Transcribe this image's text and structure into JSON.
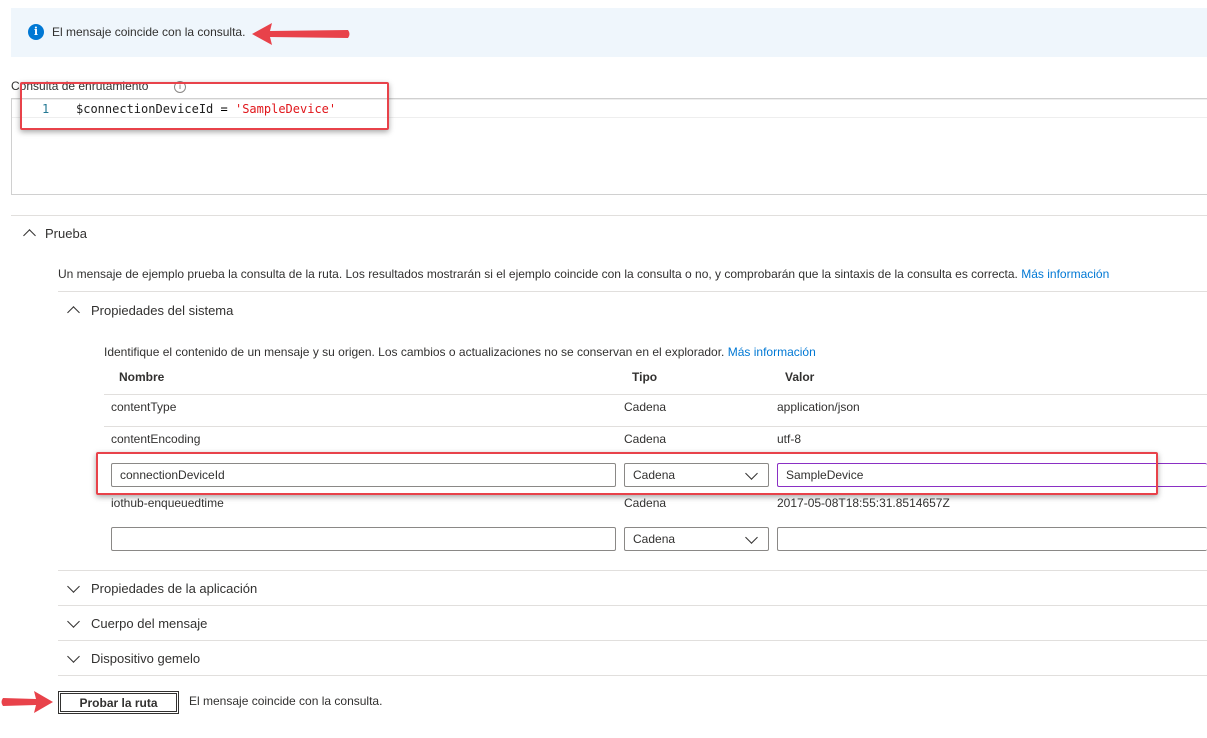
{
  "banner": {
    "message": "El mensaje coincide con la consulta.",
    "icon": "info-icon"
  },
  "query": {
    "label": "Consulta de enrutamiento",
    "line_number": "1",
    "code_var": "$connectionDeviceId",
    "code_op": " = ",
    "code_str": "'SampleDevice'"
  },
  "test": {
    "title": "Prueba",
    "description": "Un mensaje de ejemplo prueba la consulta de la ruta. Los resultados mostrarán si el ejemplo coincide con la consulta o no, y comprobarán que la sintaxis de la consulta es correcta.",
    "more_info": "Más información"
  },
  "system_props": {
    "title": "Propiedades del sistema",
    "description": "Identifique el contenido de un mensaje y su origen. Los cambios o actualizaciones no se conservan en el explorador.",
    "more_info": "Más información",
    "headers": {
      "name": "Nombre",
      "type": "Tipo",
      "value": "Valor"
    },
    "rows": [
      {
        "name": "contentType",
        "type": "Cadena",
        "value": "application/json"
      },
      {
        "name": "contentEncoding",
        "type": "Cadena",
        "value": "utf-8"
      },
      {
        "name": "connectionDeviceId",
        "type": "Cadena",
        "value": "SampleDevice"
      },
      {
        "name": "iothub-enqueuedtime",
        "type": "Cadena",
        "value": "2017-05-08T18:55:31.8514657Z"
      },
      {
        "name": "",
        "type": "Cadena",
        "value": ""
      }
    ]
  },
  "sections": {
    "app_props": "Propiedades de la aplicación",
    "body": "Cuerpo del mensaje",
    "twin": "Dispositivo gemelo"
  },
  "footer": {
    "button": "Probar la ruta",
    "result": "El mensaje coincide con la consulta."
  },
  "colors": {
    "accent": "#0078d4",
    "highlight": "#e8424a",
    "banner_bg": "#eff6fc"
  }
}
